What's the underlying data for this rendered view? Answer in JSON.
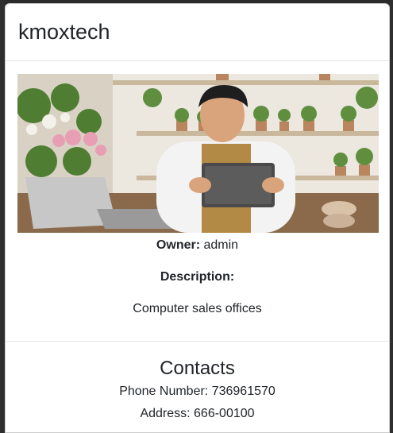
{
  "modal": {
    "title": "kmoxtech",
    "image_alt": "Florist shop owner using a tablet",
    "owner_label": "Owner:",
    "owner_value": "admin",
    "description_label": "Description:",
    "description_text": "Computer sales offices"
  },
  "contacts": {
    "title": "Contacts",
    "phone_label": "Phone Number:",
    "phone_value": "736961570",
    "address_label": "Address:",
    "address_value": "666-00100"
  }
}
